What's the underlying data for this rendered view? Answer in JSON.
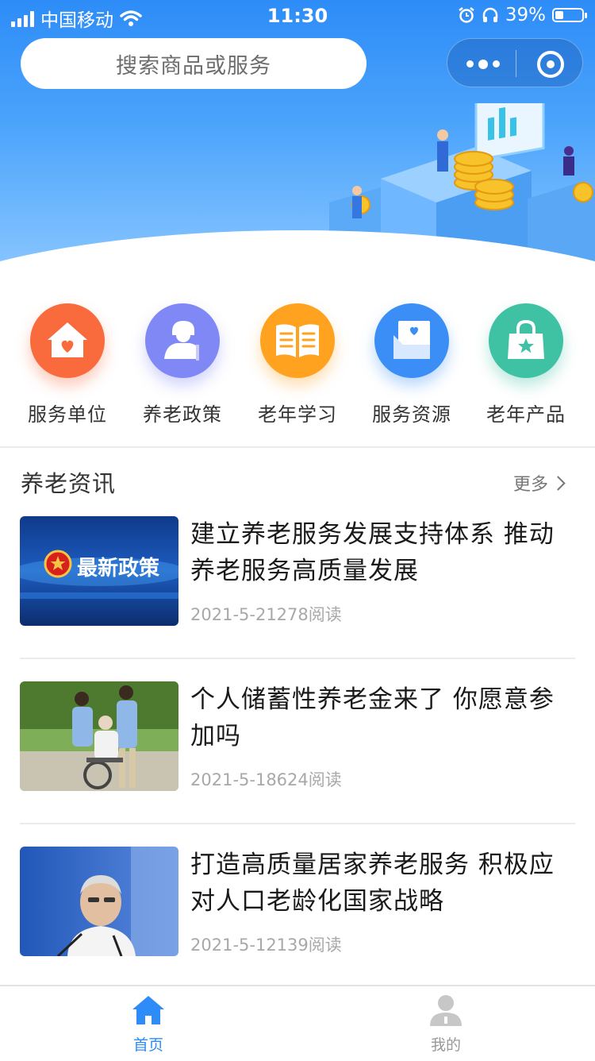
{
  "status_bar": {
    "carrier": "中国移动",
    "time": "11:30",
    "battery": "39%",
    "battery_level": 0.39,
    "icons": [
      "signal-icon",
      "wifi-icon",
      "alarm-icon",
      "headphones-icon",
      "battery-icon"
    ]
  },
  "header": {
    "search_placeholder": "搜索商品或服务",
    "capsule_icons": [
      "more-dots-icon",
      "close-target-icon"
    ]
  },
  "categories": [
    {
      "label": "服务单位",
      "icon": "home-heart-icon",
      "color": "#f96a3c"
    },
    {
      "label": "养老政策",
      "icon": "elderly-person-icon",
      "color": "#7f88f5"
    },
    {
      "label": "老年学习",
      "icon": "open-book-icon",
      "color": "#fea21f"
    },
    {
      "label": "服务资源",
      "icon": "document-heart-icon",
      "color": "#3a8ef6"
    },
    {
      "label": "老年产品",
      "icon": "shopping-bag-star-icon",
      "color": "#3fc1a4"
    }
  ],
  "news_section": {
    "title": "养老资讯",
    "more_label": "更多"
  },
  "news": [
    {
      "title": "建立养老服务发展支持体系 推动养老服务高质量发展",
      "meta": "2021-5-21278阅读",
      "thumb_text": "最新政策"
    },
    {
      "title": "个人储蓄性养老金来了 你愿意参加吗",
      "meta": "2021-5-18624阅读"
    },
    {
      "title": "打造高质量居家养老服务 积极应对人口老龄化国家战略",
      "meta": "2021-5-12139阅读"
    }
  ],
  "tabbar": {
    "tabs": [
      {
        "label": "首页",
        "icon": "home-icon",
        "active": true
      },
      {
        "label": "我的",
        "icon": "user-icon",
        "active": false
      }
    ],
    "active_color": "#2d8cf7",
    "inactive_color": "#999999"
  }
}
